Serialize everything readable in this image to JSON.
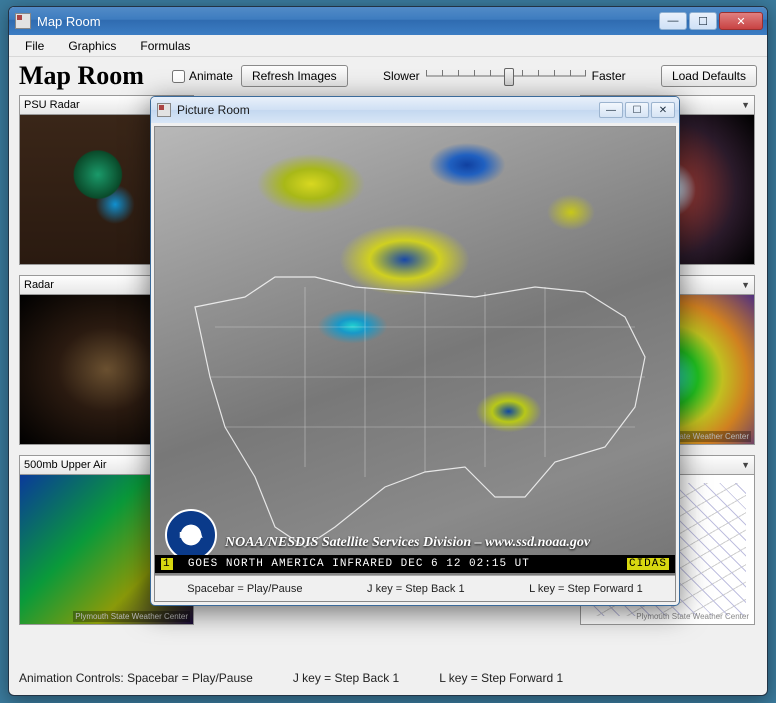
{
  "main": {
    "title": "Map Room",
    "menu": {
      "file": "File",
      "graphics": "Graphics",
      "formulas": "Formulas"
    },
    "heading": "Map Room",
    "animate_label": "Animate",
    "refresh_btn": "Refresh Images",
    "slower": "Slower",
    "faster": "Faster",
    "load_defaults": "Load Defaults"
  },
  "tiles": {
    "r1c1": "PSU Radar",
    "r2c1": "Radar",
    "r3c1": "500mb Upper Air",
    "watermark": "Plymouth State Weather Center"
  },
  "child": {
    "title": "Picture Room",
    "noaa_credit": "NOAA/NESDIS Satellite Services Division – www.ssd.noaa.gov",
    "strip_num": "1",
    "strip_text": "GOES NORTH AMERICA INFRARED DEC 6 12 02:15 UT",
    "strip_tag": "CIDAS",
    "kbd_play": "Spacebar = Play/Pause",
    "kbd_back": "J key = Step Back 1",
    "kbd_fwd": "L key = Step Forward 1"
  },
  "footer": {
    "label": "Animation Controls:",
    "play": "Spacebar = Play/Pause",
    "back": "J key = Step Back 1",
    "fwd": "L key = Step Forward 1"
  }
}
